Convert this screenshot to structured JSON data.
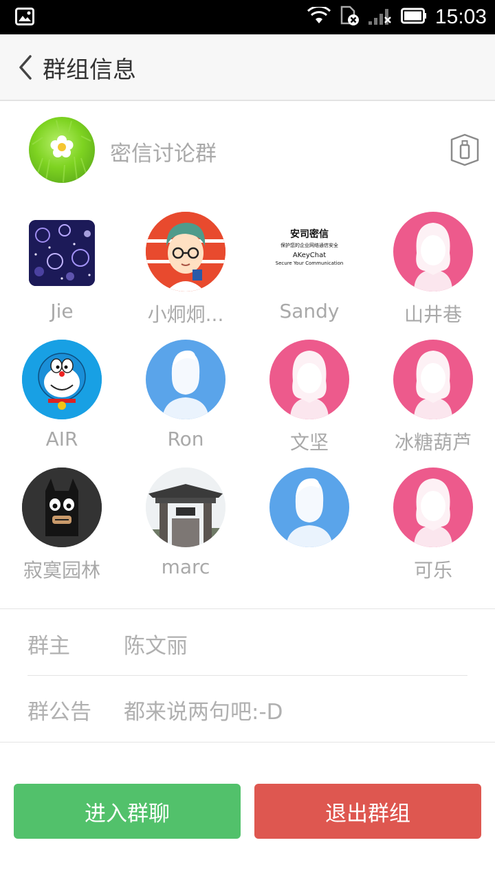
{
  "status_bar": {
    "time": "15:03"
  },
  "header": {
    "title": "群组信息"
  },
  "group": {
    "name": "密信讨论群"
  },
  "members": [
    {
      "name": "Jie",
      "avatar": "purple-bokeh-photo"
    },
    {
      "name": "小炯炯...",
      "avatar": "glasses-boy-cartoon"
    },
    {
      "name": "Sandy",
      "avatar": "akeychat-logo",
      "logo_line1": "安司密信",
      "logo_line2": "保护您的企业网络通信安全",
      "logo_line3": "AKeyChat",
      "logo_line4": "Secure Your Communication"
    },
    {
      "name": "山井巷",
      "avatar": "default-female"
    },
    {
      "name": "AIR",
      "avatar": "doraemon"
    },
    {
      "name": "Ron",
      "avatar": "default-male"
    },
    {
      "name": "文坚",
      "avatar": "default-female"
    },
    {
      "name": "冰糖葫芦",
      "avatar": "default-female"
    },
    {
      "name": "寂寞园林",
      "avatar": "batman-cartoon"
    },
    {
      "name": "marc",
      "avatar": "gate-photo"
    },
    {
      "name": "",
      "avatar": "default-male"
    },
    {
      "name": "可乐",
      "avatar": "default-female"
    }
  ],
  "info": {
    "owner_label": "群主",
    "owner_value": "陈文丽",
    "notice_label": "群公告",
    "notice_value": "都来说两句吧:-D"
  },
  "buttons": {
    "enter_label": "进入群聊",
    "exit_label": "退出群组"
  },
  "colors": {
    "enter": "#52c16b",
    "exit": "#de5750",
    "male_avatar": "#5aa4ea",
    "female_avatar": "#ed5a8c"
  }
}
